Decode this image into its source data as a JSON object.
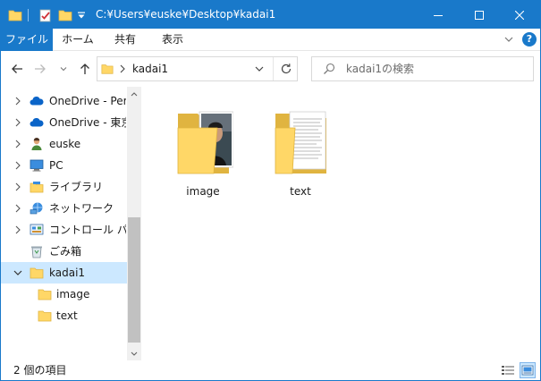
{
  "window": {
    "title": "C:¥Users¥euske¥Desktop¥kadai1"
  },
  "colors": {
    "accent": "#1979ca",
    "selection": "#cce8ff",
    "folder": "#ffd767"
  },
  "ribbon": {
    "tabs": [
      {
        "label": "ファイル",
        "active": true
      },
      {
        "label": "ホーム"
      },
      {
        "label": "共有"
      },
      {
        "label": "表示"
      }
    ],
    "help_label": "?"
  },
  "address": {
    "path": "kadai1"
  },
  "search": {
    "placeholder": "kadai1の検索"
  },
  "navpane": {
    "items": [
      {
        "label": "OneDrive - Personal",
        "icon": "onedrive-icon"
      },
      {
        "label": "OneDrive - 東京大学",
        "icon": "onedrive-icon"
      },
      {
        "label": "euske",
        "icon": "user-icon"
      },
      {
        "label": "PC",
        "icon": "pc-icon"
      },
      {
        "label": "ライブラリ",
        "icon": "library-icon"
      },
      {
        "label": "ネットワーク",
        "icon": "network-icon"
      },
      {
        "label": "コントロール パネル",
        "icon": "control-panel-icon"
      },
      {
        "label": "ごみ箱",
        "icon": "recycle-bin-icon"
      },
      {
        "label": "kadai1",
        "icon": "folder-icon",
        "selected": true,
        "expanded": true
      },
      {
        "label": "image",
        "icon": "folder-icon"
      },
      {
        "label": "text",
        "icon": "folder-icon"
      }
    ]
  },
  "content": {
    "items": [
      {
        "label": "image",
        "icon": "photo-folder-icon"
      },
      {
        "label": "text",
        "icon": "document-folder-icon"
      }
    ]
  },
  "status": {
    "item_count": "2 個の項目"
  }
}
